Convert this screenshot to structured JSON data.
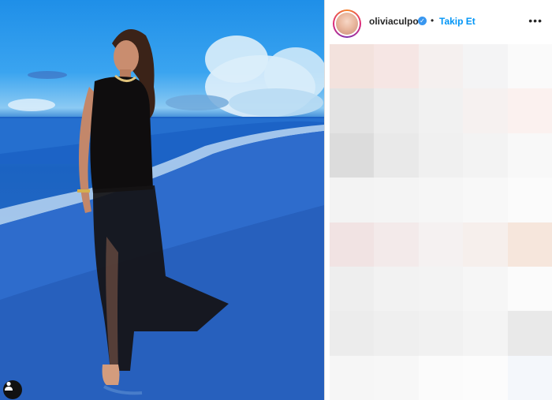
{
  "post": {
    "image_alt": "Woman in black lace dress on beach at sunset",
    "photo_user_icon": "person-icon"
  },
  "header": {
    "username": "oliviaculpo",
    "verified_icon": "verified-check-icon",
    "separator": "•",
    "follow_label": "Takip Et",
    "more_icon": "more-options-icon",
    "more_glyph": "•••"
  },
  "colors": {
    "follow_blue": "#0095f6",
    "verified_blue": "#3897f0",
    "text_dark": "#262626",
    "divider": "#dbdbdb"
  },
  "blur_cells": [
    "#f3e2dd",
    "#f6e6e4",
    "#f5f0ef",
    "#f4f4f5",
    "#fafafa",
    "#e3e3e3",
    "#ececec",
    "#f1f1f1",
    "#f6f1f0",
    "#fbf1ef",
    "#dcdcdc",
    "#e9e9e9",
    "#f0f0f0",
    "#f3f3f3",
    "#f8f8f8",
    "#f3f3f3",
    "#f4f4f4",
    "#f6f6f6",
    "#f8f8f8",
    "#fbfbfb",
    "#f1e3e3",
    "#f3eaea",
    "#f5f1f1",
    "#f6efec",
    "#f6e6dc",
    "#eeeeee",
    "#f2f2f2",
    "#f3f3f3",
    "#f6f6f6",
    "#fbfbfb",
    "#ececec",
    "#efefef",
    "#f1f1f1",
    "#f4f4f4",
    "#e9e9e9",
    "#f6f6f6",
    "#f7f7f7",
    "#fbfbfb",
    "#fcfcfc",
    "#f4f7fb"
  ]
}
